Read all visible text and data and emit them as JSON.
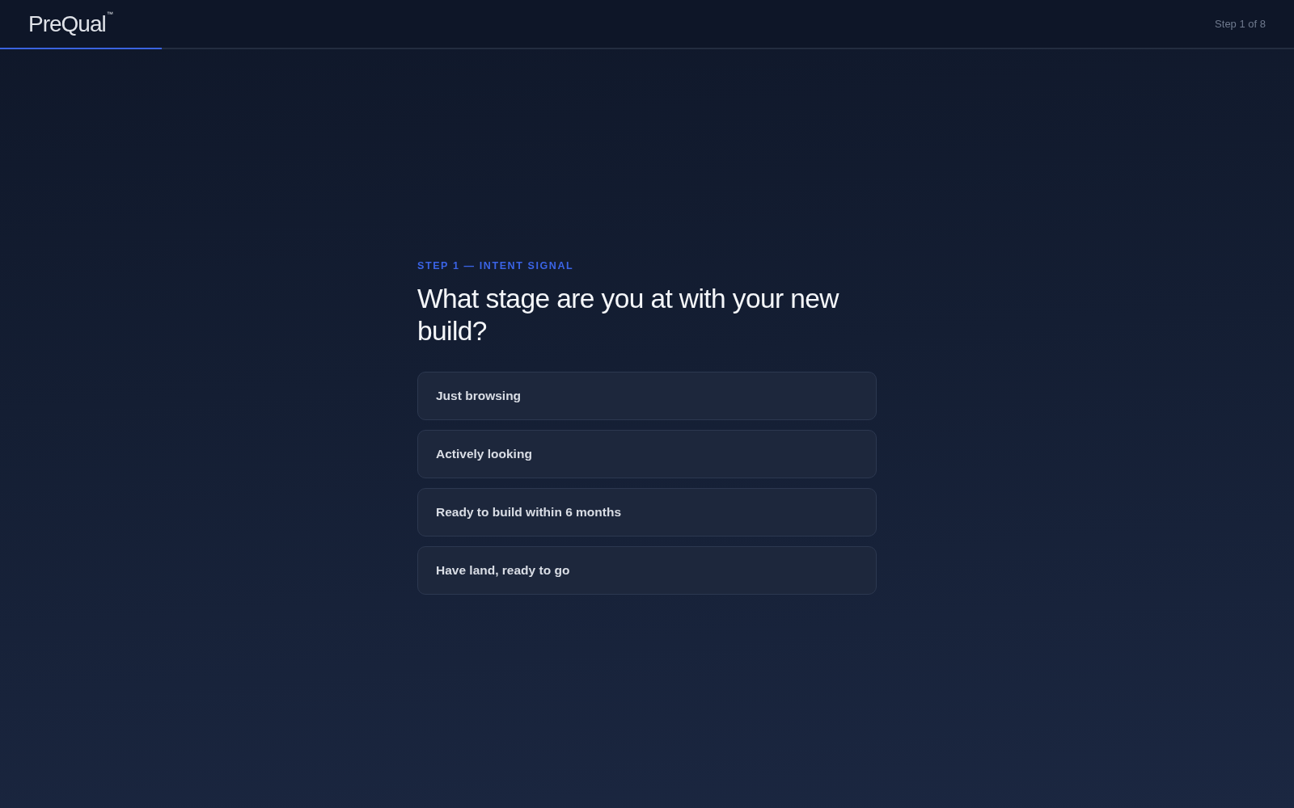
{
  "header": {
    "logo": "PreQual$^{™}$",
    "step_label": "Step 1 of 8",
    "progress": {
      "level": 0.125
    }
  },
  "question": {
    "eyebrow": "STEP 1 — INTENT SIGNAL",
    "title": "What stage are you at with your new build?",
    "options": [
      {
        "label": "Just browsing",
        "selected": false
      },
      {
        "label": "Actively looking",
        "selected": false
      },
      {
        "label": "Ready to build within 6 months",
        "selected": false
      },
      {
        "label": "Have land, ready to go",
        "selected": false
      }
    ]
  }
}
